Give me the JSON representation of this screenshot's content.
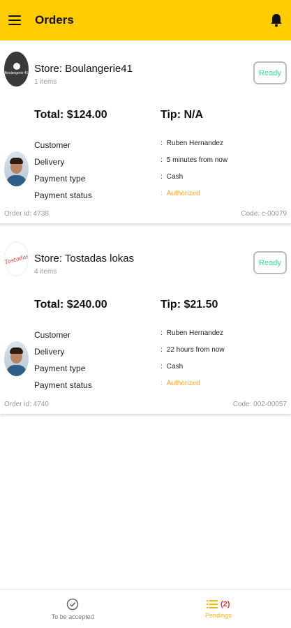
{
  "appbar": {
    "title": "Orders"
  },
  "orders": [
    {
      "store_name": "Store: Boulangerie41",
      "items": "1 items",
      "ready_label": "Ready",
      "total": "Total: $124.00",
      "tip": "Tip: N/A",
      "labels": [
        "Customer",
        "Delivery",
        "Payment type",
        "Payment status"
      ],
      "values": [
        "Ruben Hernandez",
        "5 minutes from now",
        "Cash",
        "Authorized"
      ],
      "order_id": "Order id: 4738",
      "code": "Code: c-00079",
      "logo_text": "Boulangerie 41"
    },
    {
      "store_name": "Store: Tostadas lokas",
      "items": "4 items",
      "ready_label": "Ready",
      "total": "Total: $240.00",
      "tip": "Tip: $21.50",
      "labels": [
        "Customer",
        "Delivery",
        "Payment type",
        "Payment status"
      ],
      "values": [
        "Ruben Hernandez",
        "22 hours from now",
        "Cash",
        "Authorized"
      ],
      "order_id": "Order id: 4740",
      "code": "Code: 002-00057",
      "logo_text": "Tostadas"
    }
  ],
  "bottom_nav": {
    "to_be_accepted": "To be accepted",
    "pendings": "Pendings",
    "pendings_count": "(2)"
  },
  "icons": {
    "menu": "menu-icon",
    "bell": "bell-icon",
    "check": "check-circle-icon",
    "list": "list-icon"
  },
  "colors": {
    "appbar": "#FFCC00",
    "ready": "#3ddc97",
    "authorized": "#f5a623",
    "active_tab": "#f2b90c",
    "badge": "#e53935"
  }
}
